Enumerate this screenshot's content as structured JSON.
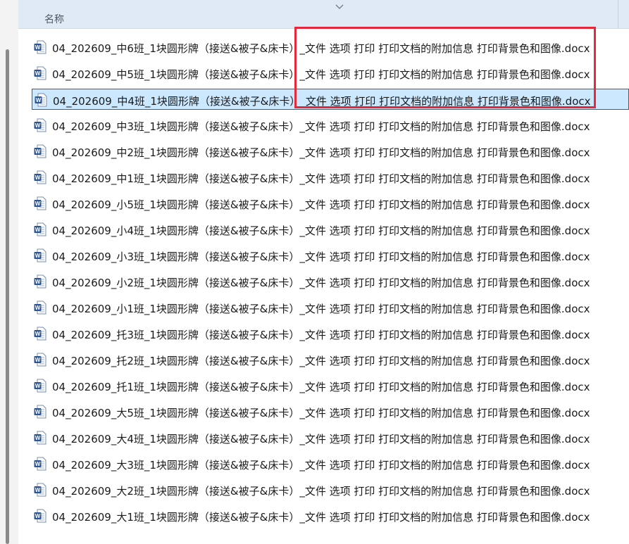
{
  "header": {
    "column_name_label": "名称",
    "sort_icon": "chevron-down-icon"
  },
  "files": [
    {
      "name": "04_202609_中6班_1块圆形牌（接送&被子&床卡）_文件 选项 打印 打印文档的附加信息 打印背景色和图像.docx",
      "selected": false
    },
    {
      "name": "04_202609_中5班_1块圆形牌（接送&被子&床卡）_文件 选项 打印 打印文档的附加信息 打印背景色和图像.docx",
      "selected": false
    },
    {
      "name": "04_202609_中4班_1块圆形牌（接送&被子&床卡）_文件 选项 打印 打印文档的附加信息 打印背景色和图像.docx",
      "selected": true
    },
    {
      "name": "04_202609_中3班_1块圆形牌（接送&被子&床卡）_文件 选项 打印 打印文档的附加信息 打印背景色和图像.docx",
      "selected": false
    },
    {
      "name": "04_202609_中2班_1块圆形牌（接送&被子&床卡）_文件 选项 打印 打印文档的附加信息 打印背景色和图像.docx",
      "selected": false
    },
    {
      "name": "04_202609_中1班_1块圆形牌（接送&被子&床卡）_文件 选项 打印 打印文档的附加信息 打印背景色和图像.docx",
      "selected": false
    },
    {
      "name": "04_202609_小5班_1块圆形牌（接送&被子&床卡）_文件 选项 打印 打印文档的附加信息 打印背景色和图像.docx",
      "selected": false
    },
    {
      "name": "04_202609_小4班_1块圆形牌（接送&被子&床卡）_文件 选项 打印 打印文档的附加信息 打印背景色和图像.docx",
      "selected": false
    },
    {
      "name": "04_202609_小3班_1块圆形牌（接送&被子&床卡）_文件 选项 打印 打印文档的附加信息 打印背景色和图像.docx",
      "selected": false
    },
    {
      "name": "04_202609_小2班_1块圆形牌（接送&被子&床卡）_文件 选项 打印 打印文档的附加信息 打印背景色和图像.docx",
      "selected": false
    },
    {
      "name": "04_202609_小1班_1块圆形牌（接送&被子&床卡）_文件 选项 打印 打印文档的附加信息 打印背景色和图像.docx",
      "selected": false
    },
    {
      "name": "04_202609_托3班_1块圆形牌（接送&被子&床卡）_文件 选项 打印 打印文档的附加信息 打印背景色和图像.docx",
      "selected": false
    },
    {
      "name": "04_202609_托2班_1块圆形牌（接送&被子&床卡）_文件 选项 打印 打印文档的附加信息 打印背景色和图像.docx",
      "selected": false
    },
    {
      "name": "04_202609_托1班_1块圆形牌（接送&被子&床卡）_文件 选项 打印 打印文档的附加信息 打印背景色和图像.docx",
      "selected": false
    },
    {
      "name": "04_202609_大5班_1块圆形牌（接送&被子&床卡）_文件 选项 打印 打印文档的附加信息 打印背景色和图像.docx",
      "selected": false
    },
    {
      "name": "04_202609_大4班_1块圆形牌（接送&被子&床卡）_文件 选项 打印 打印文档的附加信息 打印背景色和图像.docx",
      "selected": false
    },
    {
      "name": "04_202609_大3班_1块圆形牌（接送&被子&床卡）_文件 选项 打印 打印文档的附加信息 打印背景色和图像.docx",
      "selected": false
    },
    {
      "name": "04_202609_大2班_1块圆形牌（接送&被子&床卡）_文件 选项 打印 打印文档的附加信息 打印背景色和图像.docx",
      "selected": false
    },
    {
      "name": "04_202609_大1班_1块圆形牌（接送&被子&床卡）_文件 选项 打印 打印文档的附加信息 打印背景色和图像.docx",
      "selected": false
    }
  ],
  "file_icon": "word-document-icon",
  "colors": {
    "header_bg": "#dfeaf5",
    "selection_bg": "#cce8ff",
    "selection_border": "#555b63",
    "annotation_red": "#e5283a",
    "word_blue": "#2b579a"
  }
}
